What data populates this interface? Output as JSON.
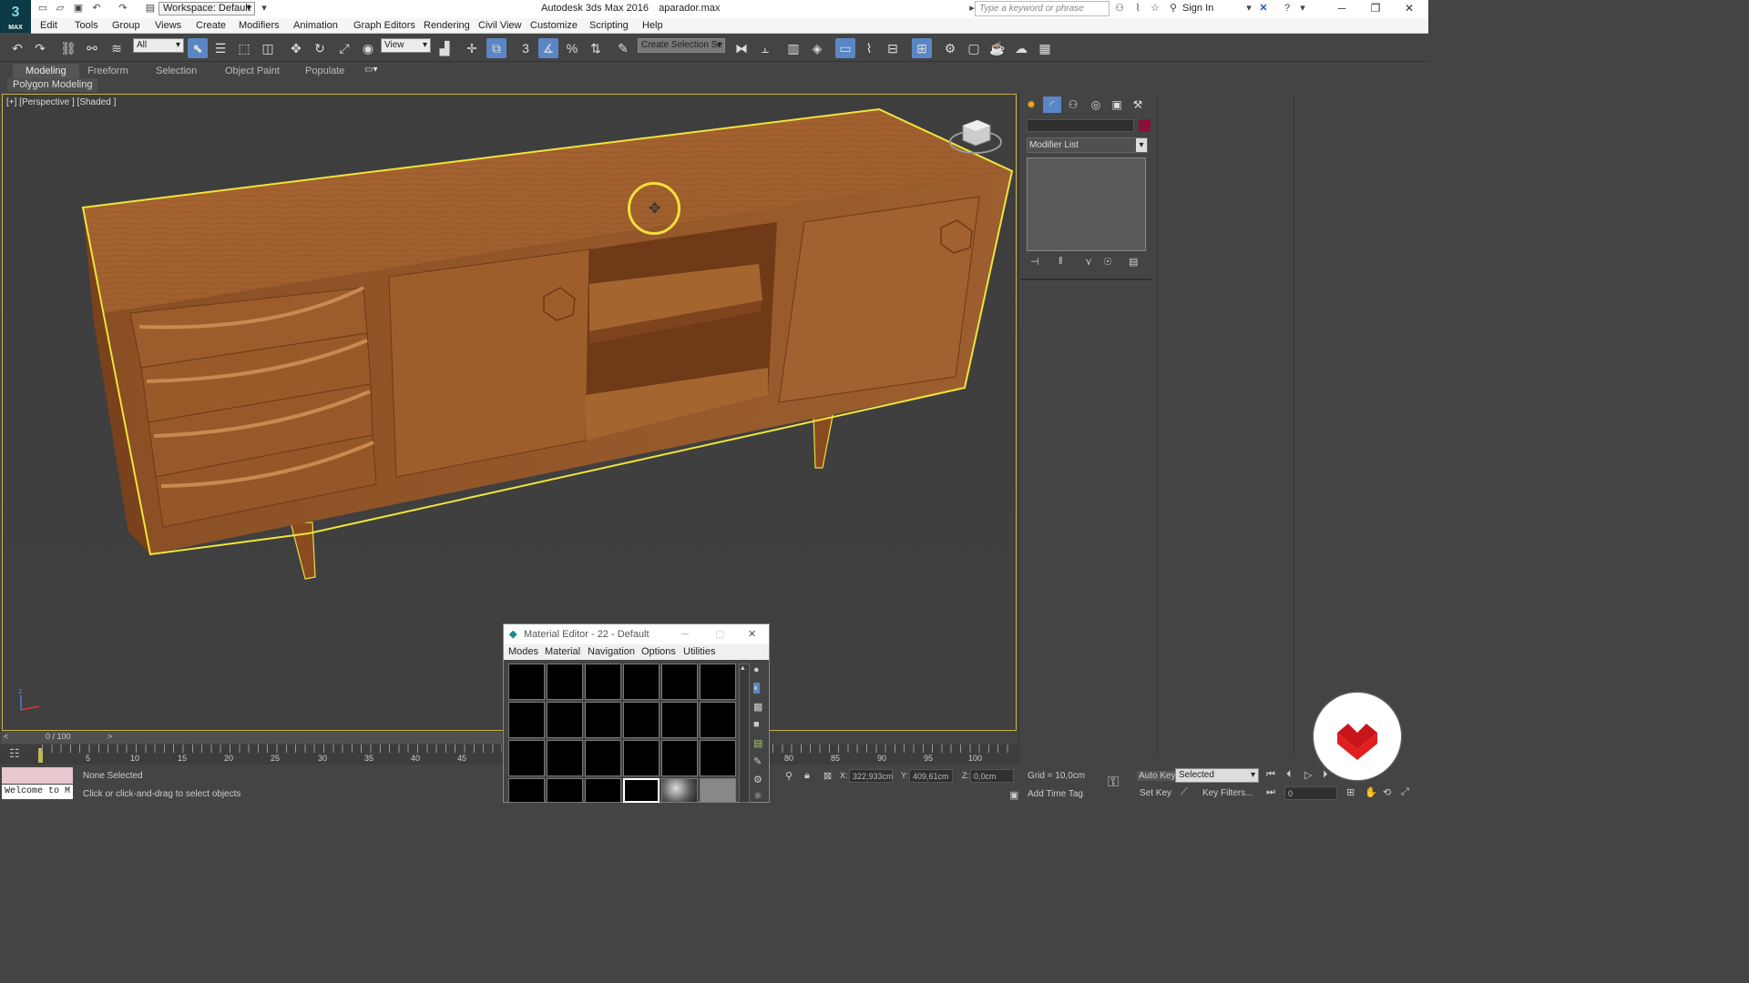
{
  "titlebar": {
    "logo_text": "3",
    "logo_sub": "MAX",
    "workspace_label": "Workspace: Default",
    "app_name": "Autodesk 3ds Max 2016",
    "file_name": "aparador.max",
    "search_placeholder": "Type a keyword or phrase",
    "sign_in": "Sign In"
  },
  "menubar": {
    "items": [
      "Edit",
      "Tools",
      "Group",
      "Views",
      "Create",
      "Modifiers",
      "Animation",
      "Graph Editors",
      "Rendering",
      "Civil View",
      "Customize",
      "Scripting",
      "Help"
    ]
  },
  "toolbar": {
    "selection_filter": "All",
    "reference_coord": "View",
    "selection_set": "Create Selection Se",
    "snap_label": "3"
  },
  "ribbon": {
    "tabs": [
      "Modeling",
      "Freeform",
      "Selection",
      "Object Paint",
      "Populate"
    ],
    "active_tab": "Modeling",
    "sub_panel": "Polygon Modeling"
  },
  "viewport": {
    "label": "[+] [Perspective ] [Shaded ]",
    "accent_color": "#c8b44a",
    "selection_highlight": "#f3e03a"
  },
  "command_panel": {
    "modifier_list": "Modifier List",
    "object_color": "#8b0f3a"
  },
  "timeline": {
    "frame_counter": "0 / 100",
    "ticks": [
      "5",
      "10",
      "15",
      "20",
      "25",
      "30",
      "35",
      "40",
      "45",
      "80",
      "85",
      "90",
      "95",
      "100"
    ]
  },
  "status": {
    "welcome": "Welcome to M",
    "selection_status": "None Selected",
    "prompt": "Click or click-and-drag to select objects",
    "x_label": "X:",
    "x_value": "322,933cm",
    "y_label": "Y:",
    "y_value": "409,61cm",
    "z_label": "Z:",
    "z_value": "0,0cm",
    "grid": "Grid = 10,0cm",
    "add_time_tag": "Add Time Tag"
  },
  "animation_controls": {
    "auto_key": "Auto Key",
    "set_key": "Set Key",
    "key_mode": "Selected",
    "key_filters": "Key Filters...",
    "current_frame": "0"
  },
  "material_editor": {
    "title": "Material Editor - 22 - Default",
    "menu": [
      "Modes",
      "Material",
      "Navigation",
      "Options",
      "Utilities"
    ]
  }
}
